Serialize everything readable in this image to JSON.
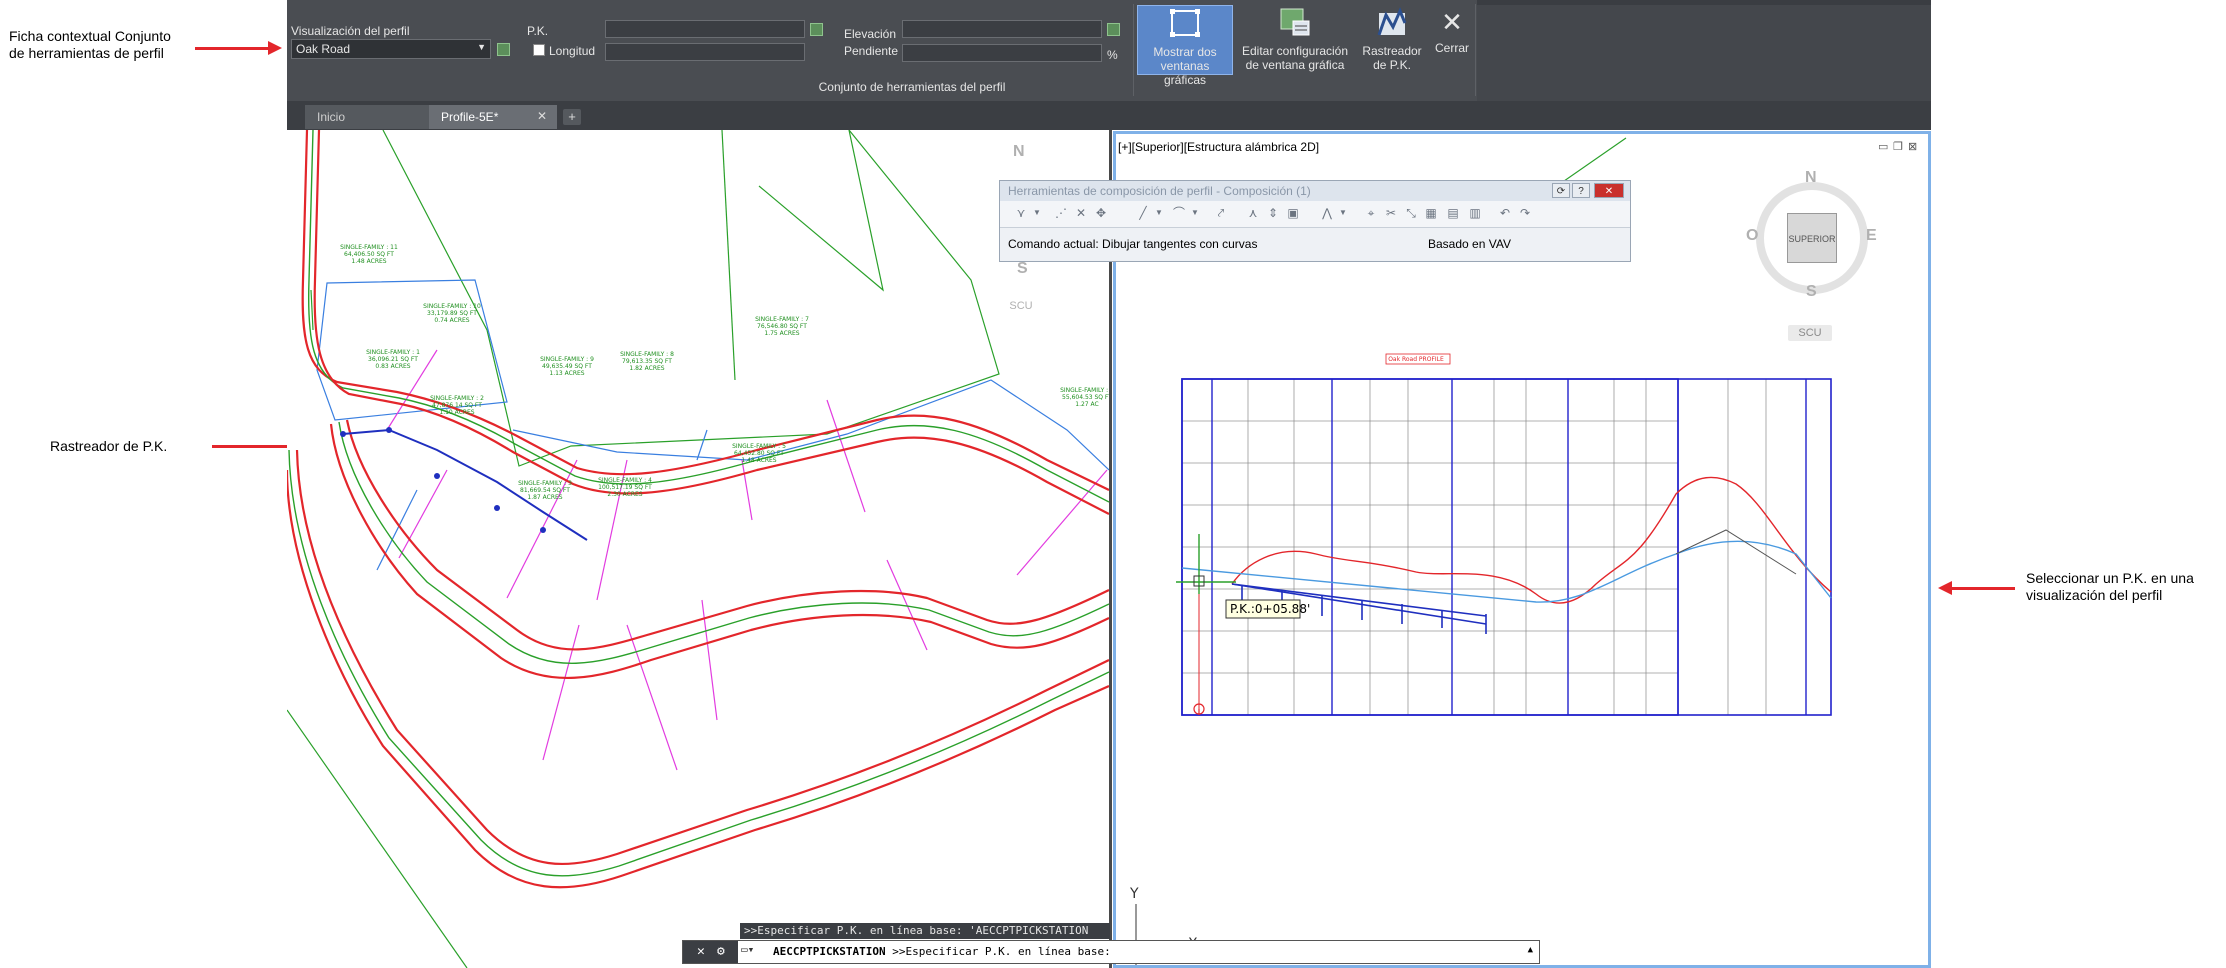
{
  "callouts": {
    "ficha": "Ficha contextual Conjunto\nde herramientas de perfil",
    "rastreador": "Rastreador de P.K.",
    "seleccionar": "Seleccionar un P.K. en una\nvisualización del perfil"
  },
  "ribbon": {
    "profile_view_label": "Visualización del perfil",
    "profile_view_value": "Oak Road",
    "station_label": "P.K.",
    "length_label": "Longitud",
    "elevation_label": "Elevación",
    "grade_label": "Pendiente",
    "grade_unit": "%",
    "panel_title": "Conjunto de herramientas del perfil",
    "buttons": {
      "show_two": "Mostrar dos\nventanas gráficas",
      "edit_config": "Editar configuración\nde ventana gráfica",
      "tracker": "Rastreador\nde P.K.",
      "close": "Cerrar"
    }
  },
  "tabs": [
    {
      "label": "Inicio"
    },
    {
      "label": "Profile-5E*"
    }
  ],
  "add_tab": "+",
  "right_viewport_label": "[+][Superior][Estructura alámbrica 2D]",
  "toolbox": {
    "title": "Herramientas de composición de perfil - Composición (1)",
    "current_command": "Comando actual: Dibujar tangentes con curvas",
    "based_on": "Basado en VAV"
  },
  "navcube": {
    "n": "N",
    "s": "S",
    "e": "E",
    "w": "O",
    "face": "SUPERIOR",
    "ucs": "SCU"
  },
  "station_tooltip": "P.K.:0+05.88'",
  "command_history": ">>Especificar P.K. en línea base: 'AECCPTPICKSTATION",
  "command_line": {
    "command": "AECCPTPICKSTATION",
    "prompt": ">>Especificar P.K. en línea base:"
  },
  "axis_y": "Y",
  "axis_x": "X",
  "plan_labels": [
    "SINGLE-FAMILY : 11\n64,406.50 SQ FT\n1.48 ACRES",
    "SINGLE-FAMILY : 10\n33,179.89 SQ FT\n0.74 ACRES",
    "SINGLE-FAMILY : 1\n36,096.21 SQ FT\n0.83 ACRES",
    "SINGLE-FAMILY : 9\n49,635.49 SQ FT\n1.13 ACRES",
    "SINGLE-FAMILY : 8\n79,613.35 SQ FT\n1.82 ACRES",
    "SINGLE-FAMILY : 7\n76,546.80 SQ FT\n1.75 ACRES",
    "SINGLE-FAMILY : 2\n47,876.14 SQ FT\n1.10 ACRES",
    "SINGLE-FAMILY : 3\n81,669.54 SQ FT\n1.87 ACRES",
    "SINGLE-FAMILY : 4\n100,517.19 SQ FT\n2.30 ACRES",
    "SINGLE-FAMILY : 5\n64,452.80 SQ FT\n1.48 ACRES",
    "SINGLE-FAMILY : 6\n55,604.53 SQ FT\n1.27 AC"
  ],
  "profile_title": "Oak Road PROFILE",
  "colors": {
    "ribbon": "#4a4d52",
    "active_button": "#5b87c9",
    "alignment": "#e3262b",
    "parcel_green": "#2aa02a",
    "parcel_magenta": "#e23ce0",
    "grid_blue": "#2222cc",
    "profile_blue": "#4a9ae0"
  }
}
